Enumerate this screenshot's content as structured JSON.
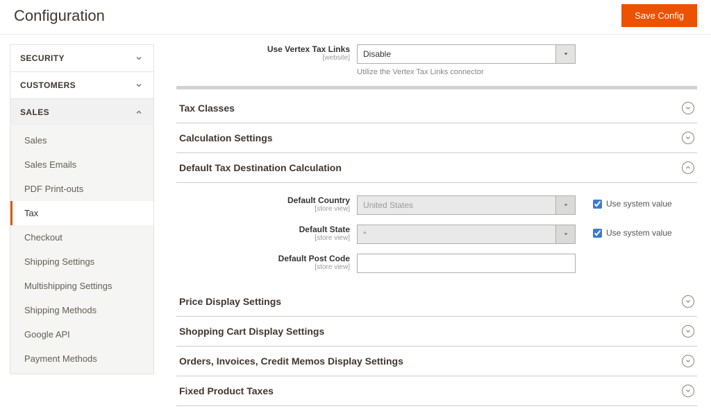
{
  "header": {
    "title": "Configuration",
    "save_label": "Save Config"
  },
  "sidebar": {
    "groups": [
      {
        "label": "SECURITY",
        "open": false
      },
      {
        "label": "CUSTOMERS",
        "open": false
      },
      {
        "label": "SALES",
        "open": true
      }
    ],
    "salesItems": [
      "Sales",
      "Sales Emails",
      "PDF Print-outs",
      "Tax",
      "Checkout",
      "Shipping Settings",
      "Multishipping Settings",
      "Shipping Methods",
      "Google API",
      "Payment Methods"
    ],
    "activeItem": "Tax"
  },
  "vertex": {
    "label": "Use Vertex Tax Links",
    "scope": "[website]",
    "value": "Disable",
    "hint": "Utilize the Vertex Tax Links connector"
  },
  "sections": {
    "tax_classes": "Tax Classes",
    "calc_settings": "Calculation Settings",
    "default_dest": "Default Tax Destination Calculation",
    "price_display": "Price Display Settings",
    "cart_display": "Shopping Cart Display Settings",
    "orders_display": "Orders, Invoices, Credit Memos Display Settings",
    "fixed_taxes": "Fixed Product Taxes"
  },
  "defaultDest": {
    "country": {
      "label": "Default Country",
      "scope": "[store view]",
      "value": "United States",
      "system_label": "Use system value"
    },
    "state": {
      "label": "Default State",
      "scope": "[store view]",
      "value": "*",
      "system_label": "Use system value"
    },
    "post": {
      "label": "Default Post Code",
      "scope": "[store view]",
      "value": ""
    }
  }
}
